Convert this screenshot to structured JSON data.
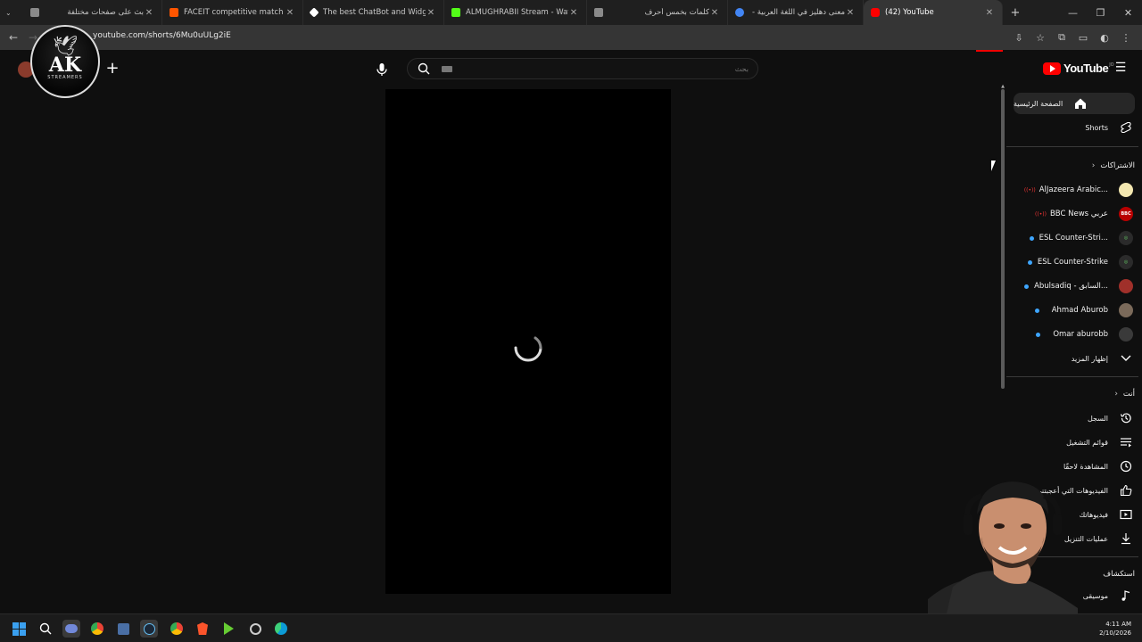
{
  "browser": {
    "tabs": [
      {
        "title": "بث على صفحات مختلفة",
        "favicon_color": "#8a8a8a",
        "active": false
      },
      {
        "title": "FACEIT competitive match - FA",
        "favicon_color": "#ff5500",
        "active": false
      },
      {
        "title": "The best ChatBot and Widgets",
        "favicon_color": "#ffffff",
        "active": false
      },
      {
        "title": "ALMUGHRABII Stream - Watch",
        "favicon_color": "#53fc18",
        "active": false
      },
      {
        "title": "كلمات بخمس أحرف",
        "favicon_color": "#8a8a8a",
        "active": false
      },
      {
        "title": "معنى دهليز في اللغة العربية - بـ",
        "favicon_color": "#4285f4",
        "active": false
      },
      {
        "title": "(42) YouTube",
        "favicon_color": "#ff0000",
        "active": true
      }
    ],
    "url": "youtube.com/shorts/6Mu0uULg2iE"
  },
  "header": {
    "search_placeholder": "بحث",
    "logo_text": "YouTube",
    "country_code": "JO"
  },
  "overlay_logo": {
    "main": "AK",
    "sub": "STREAMERS"
  },
  "sidebar": {
    "home": "الصفحة الرئيسية",
    "shorts": "Shorts",
    "subscriptions_header": "الاشتراكات",
    "channels": [
      {
        "name": "AlJazeera Arabic...",
        "avatar_color": "#f3e7b0",
        "live": true
      },
      {
        "name": "BBC News عربي",
        "avatar_color": "#b80000",
        "live": true
      },
      {
        "name": "ESL Counter-Stri...",
        "avatar_color": "#2b2b2b",
        "live": false
      },
      {
        "name": "ESL Counter-Strike",
        "avatar_color": "#2b2b2b",
        "live": false
      },
      {
        "name": "Abulsadiq - السابق...",
        "avatar_color": "#a0302a",
        "live": false
      },
      {
        "name": "Ahmad Aburob",
        "avatar_color": "#7b6a5a",
        "live": false
      },
      {
        "name": "Omar aburobb",
        "avatar_color": "#3a3a3a",
        "live": false
      }
    ],
    "show_more": "إظهار المزيد",
    "you_header": "أنت",
    "you_items": [
      {
        "label": "السجل",
        "icon": "history-icon"
      },
      {
        "label": "قوائم التشغيل",
        "icon": "playlists-icon"
      },
      {
        "label": "المشاهدة لاحقًا",
        "icon": "watch-later-icon"
      },
      {
        "label": "الفيديوهات التي أعجبتني",
        "icon": "like-icon"
      },
      {
        "label": "فيديوهاتك",
        "icon": "your-videos-icon"
      },
      {
        "label": "عمليات التنزيل",
        "icon": "download-icon"
      }
    ],
    "explore_header": "استكشاف",
    "explore_items": [
      {
        "label": "موسيقى",
        "icon": "music-icon"
      }
    ]
  },
  "taskbar": {
    "time": "4:11 AM",
    "date": "2/10/2026"
  }
}
